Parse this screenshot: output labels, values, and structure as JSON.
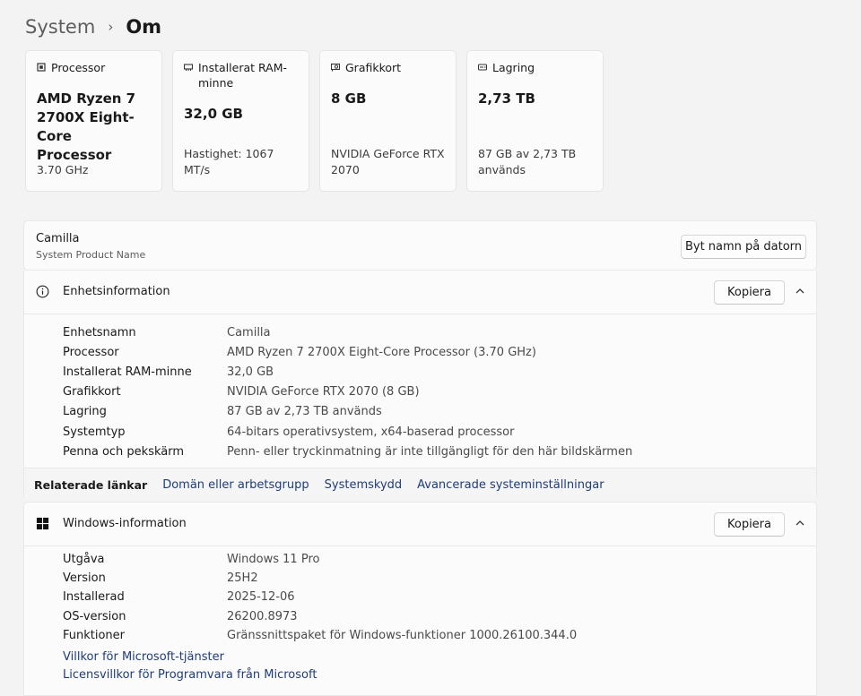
{
  "breadcrumb": {
    "parent": "System",
    "separator": "›",
    "current": "Om"
  },
  "cards": [
    {
      "icon": "processor-icon",
      "label": "Processor",
      "value": "AMD Ryzen 7 2700X Eight-Core Processor",
      "sub": "3.70 GHz"
    },
    {
      "icon": "ram-icon",
      "label": "Installerat RAM-minne",
      "value": "32,0 GB",
      "sub": "Hastighet: 1067 MT/s"
    },
    {
      "icon": "graphics-card-icon",
      "label": "Grafikkort",
      "value": "8 GB",
      "sub": "NVIDIA GeForce RTX 2070"
    },
    {
      "icon": "storage-icon",
      "label": "Lagring",
      "value": "2,73 TB",
      "sub": "87 GB av 2,73 TB används"
    }
  ],
  "device": {
    "name": "Camilla",
    "sub": "System Product Name",
    "rename_label": "Byt namn på datorn"
  },
  "device_info": {
    "title": "Enhetsinformation",
    "copy_label": "Kopiera",
    "rows": [
      {
        "k": "Enhetsnamn",
        "v": "Camilla"
      },
      {
        "k": "Processor",
        "v": "AMD Ryzen 7 2700X Eight-Core Processor (3.70 GHz)"
      },
      {
        "k": "Installerat RAM-minne",
        "v": "32,0 GB"
      },
      {
        "k": "Grafikkort",
        "v": "NVIDIA GeForce RTX 2070 (8 GB)"
      },
      {
        "k": "Lagring",
        "v": "87 GB av 2,73 TB används"
      },
      {
        "k": "Systemtyp",
        "v": "64-bitars operativsystem, x64-baserad processor"
      },
      {
        "k": "Penna och pekskärm",
        "v": "Penn- eller tryckinmatning är inte tillgängligt för den här bildskärmen"
      }
    ]
  },
  "related": {
    "label": "Relaterade länkar",
    "links": [
      "Domän eller arbetsgrupp",
      "Systemskydd",
      "Avancerade systeminställningar"
    ]
  },
  "windows_info": {
    "title": "Windows-information",
    "copy_label": "Kopiera",
    "rows": [
      {
        "k": "Utgåva",
        "v": "Windows 11 Pro"
      },
      {
        "k": "Version",
        "v": "25H2"
      },
      {
        "k": "Installerad",
        "v": "2025-12-06"
      },
      {
        "k": "OS-version",
        "v": "26200.8973"
      },
      {
        "k": "Funktioner",
        "v": "Gränssnittspaket för Windows-funktioner 1000.26100.344.0"
      }
    ],
    "links": [
      "Villkor för Microsoft-tjänster",
      "Licensvillkor för Programvara från Microsoft"
    ]
  }
}
